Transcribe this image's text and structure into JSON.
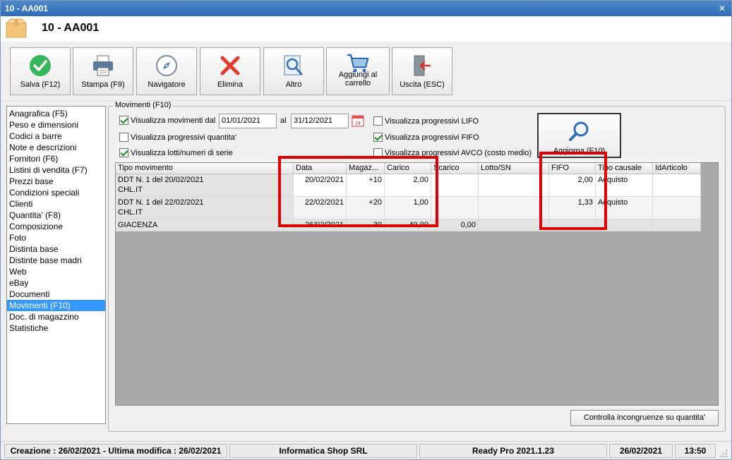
{
  "window": {
    "title": "10 - AA001",
    "close_glyph": "✕"
  },
  "header": {
    "title": "10 - AA001",
    "icon": "package-icon"
  },
  "toolbar": [
    {
      "label": "Salva (F12)",
      "icon": "check-circle-icon"
    },
    {
      "label": "Stampa (F9)",
      "icon": "printer-icon"
    },
    {
      "label": "Navigatore",
      "icon": "compass-icon"
    },
    {
      "label": "Elimina",
      "icon": "delete-x-icon"
    },
    {
      "label": "Altro",
      "icon": "magnifier-document-icon"
    },
    {
      "label": "Aggiungi al carrello",
      "icon": "cart-icon"
    },
    {
      "label": "Uscita (ESC)",
      "icon": "exit-door-icon"
    }
  ],
  "sidebar": {
    "items": [
      "Anagrafica (F5)",
      "Peso e dimensioni",
      "Codici a barre",
      "Note e descrizioni",
      "Fornitori (F6)",
      "Listini di vendita (F7)",
      "Prezzi base",
      "Condizioni speciali",
      "Clienti",
      "Quantita' (F8)",
      "Composizione",
      "Foto",
      "Distinta base",
      "Distinte base madri",
      "Web",
      "eBay",
      "Documenti",
      "Movimenti (F10)",
      "Doc. di magazzino",
      "Statistiche"
    ],
    "selected_index": 17
  },
  "movimenti": {
    "group_label": "Movimenti (F10)",
    "show_movements": {
      "label": "Visualizza movimenti dal",
      "checked": true
    },
    "date_from": "01/01/2021",
    "date_to_label": "al",
    "date_to": "31/12/2021",
    "calendar_icon": "calendar-icon",
    "prog_qty": {
      "label": "Visualizza progressivi quantita'",
      "checked": false
    },
    "lots": {
      "label": "Visualizza lotti/numeri di serie",
      "checked": true
    },
    "lifo": {
      "label": "Visualizza progressivi LIFO",
      "checked": false
    },
    "fifo": {
      "label": "Visualizza progressivi FIFO",
      "checked": true
    },
    "avco": {
      "label": "Visualizza progressivi AVCO (costo medio)",
      "checked": false
    },
    "refresh_button": {
      "label": "Aggiorna (F10)",
      "icon": "search-icon"
    },
    "check_button": "Controlla incongruenze su quantita'"
  },
  "grid": {
    "columns": [
      "Tipo movimento",
      "Data",
      "Magaz...",
      "Carico",
      "Scarico",
      "Lotto/SN",
      "FIFO",
      "Tipo causale",
      "IdArticolo"
    ],
    "rows": [
      {
        "tipo": "DDT N. 1 del 20/02/2021",
        "tipo2": "CHL.IT",
        "data": "20/02/2021",
        "magaz": "+10",
        "carico": "2,00",
        "scarico": "",
        "lotto": "",
        "fifo": "2,00",
        "causale": "Acquisto",
        "id": ""
      },
      {
        "tipo": "DDT N. 1 del 22/02/2021",
        "tipo2": "CHL.IT",
        "data": "22/02/2021",
        "magaz": "+20",
        "carico": "1,00",
        "scarico": "",
        "lotto": "",
        "fifo": "1,33",
        "causale": "Acquisto",
        "id": ""
      },
      {
        "tipo": "GIACENZA",
        "tipo2": "",
        "data": "26/02/2021",
        "magaz": "30",
        "carico": "40,00",
        "scarico": "0,00",
        "lotto": "",
        "fifo": "",
        "causale": "",
        "id": ""
      }
    ]
  },
  "statusbar": {
    "info": "Creazione : 26/02/2021 - Ultima modifica : 26/02/2021",
    "company": "Informatica Shop SRL",
    "version": "Ready Pro 2021.1.23",
    "date": "26/02/2021",
    "time": "13:50"
  },
  "colors": {
    "accent": "#3399ff",
    "highlight_box": "#e00000",
    "title_bar": "#3a78c0"
  }
}
